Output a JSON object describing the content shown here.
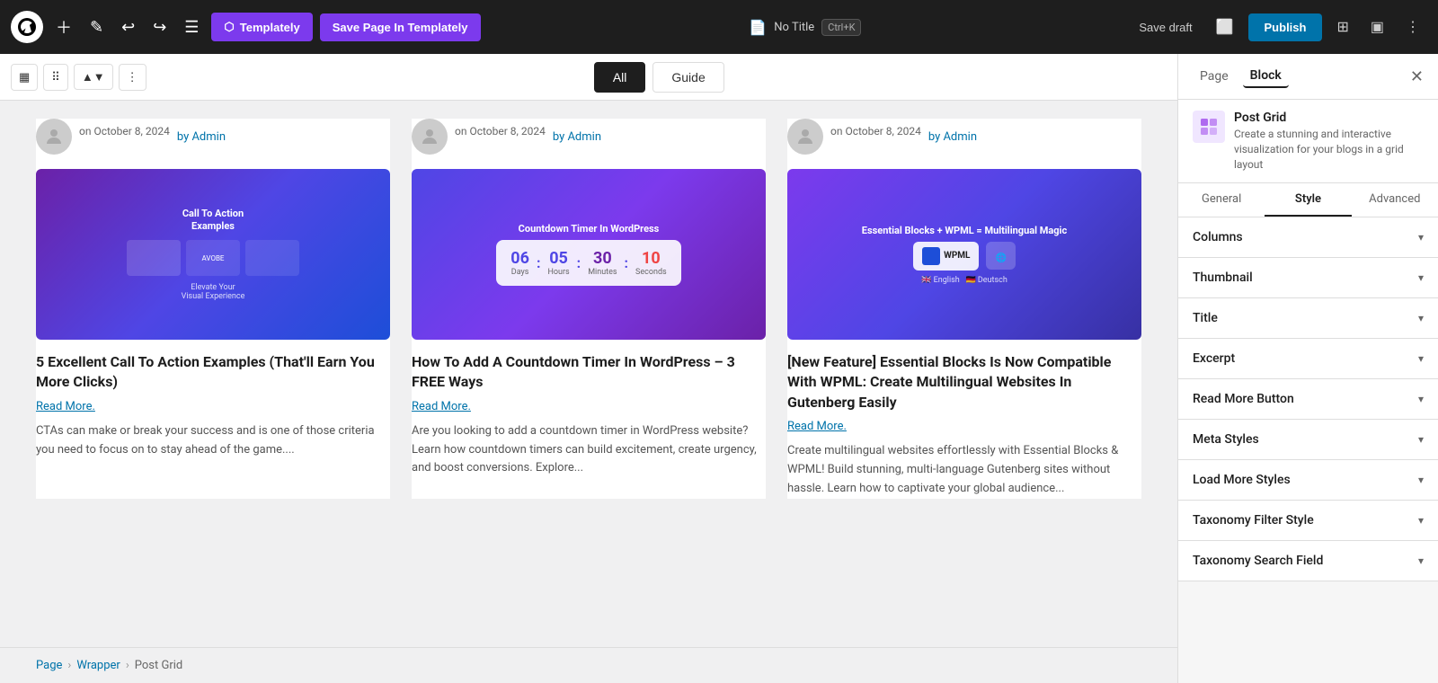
{
  "toolbar": {
    "wp_logo": "W",
    "templately_label": "Templately",
    "save_page_label": "Save Page In Templately",
    "search_placeholder": "",
    "no_title_label": "No Title",
    "shortcut": "Ctrl+K",
    "save_draft_label": "Save draft",
    "publish_label": "Publish"
  },
  "block_toolbar": {
    "filter_tabs": [
      {
        "label": "All",
        "active": true
      },
      {
        "label": "Guide",
        "active": false
      }
    ]
  },
  "posts": [
    {
      "date": "on October 8, 2024",
      "author": "by Admin",
      "title": "5 Excellent Call To Action Examples (That'll Earn You More Clicks)",
      "read_more": "Read More.",
      "excerpt": "CTAs can make or break your success and is one of those criteria you need to focus on to stay ahead of the game....",
      "img_class": "img-cta",
      "img_label": "Call To Action Examples"
    },
    {
      "date": "on October 8, 2024",
      "author": "by Admin",
      "title": "How To Add A Countdown Timer In WordPress – 3 FREE Ways",
      "read_more": "Read More.",
      "excerpt": "Are you looking to add a countdown timer in WordPress website? Learn how countdown timers can build excitement, create urgency, and boost conversions. Explore...",
      "img_class": "img-countdown",
      "img_label": "Countdown Timer In WordPress"
    },
    {
      "date": "on October 8, 2024",
      "author": "by Admin",
      "title": "[New Feature] Essential Blocks Is Now Compatible With WPML: Create Multilingual Websites In Gutenberg Easily",
      "read_more": "Read More.",
      "excerpt": "Create multilingual websites effortlessly with Essential Blocks & WPML! Build stunning, multi-language Gutenberg sites without hassle. Learn how to captivate your global audience...",
      "img_class": "img-wpml",
      "img_label": "Essential Blocks + WPML = Multilingual Magic"
    }
  ],
  "breadcrumb": {
    "items": [
      "Page",
      "Wrapper",
      "Post Grid"
    ]
  },
  "sidebar": {
    "tabs": [
      "Page",
      "Block"
    ],
    "active_tab": "Block",
    "block_icon": "▦",
    "block_title": "Post Grid",
    "block_description": "Create a stunning and interactive visualization for your blogs in a grid layout",
    "panel_tabs": [
      "General",
      "Style",
      "Advanced"
    ],
    "active_panel_tab": "Style",
    "accordion_items": [
      {
        "label": "Columns"
      },
      {
        "label": "Thumbnail"
      },
      {
        "label": "Title"
      },
      {
        "label": "Excerpt"
      },
      {
        "label": "Read More Button"
      },
      {
        "label": "Meta Styles"
      },
      {
        "label": "Load More Styles"
      },
      {
        "label": "Taxonomy Filter Style"
      },
      {
        "label": "Taxonomy Search Field"
      }
    ]
  }
}
